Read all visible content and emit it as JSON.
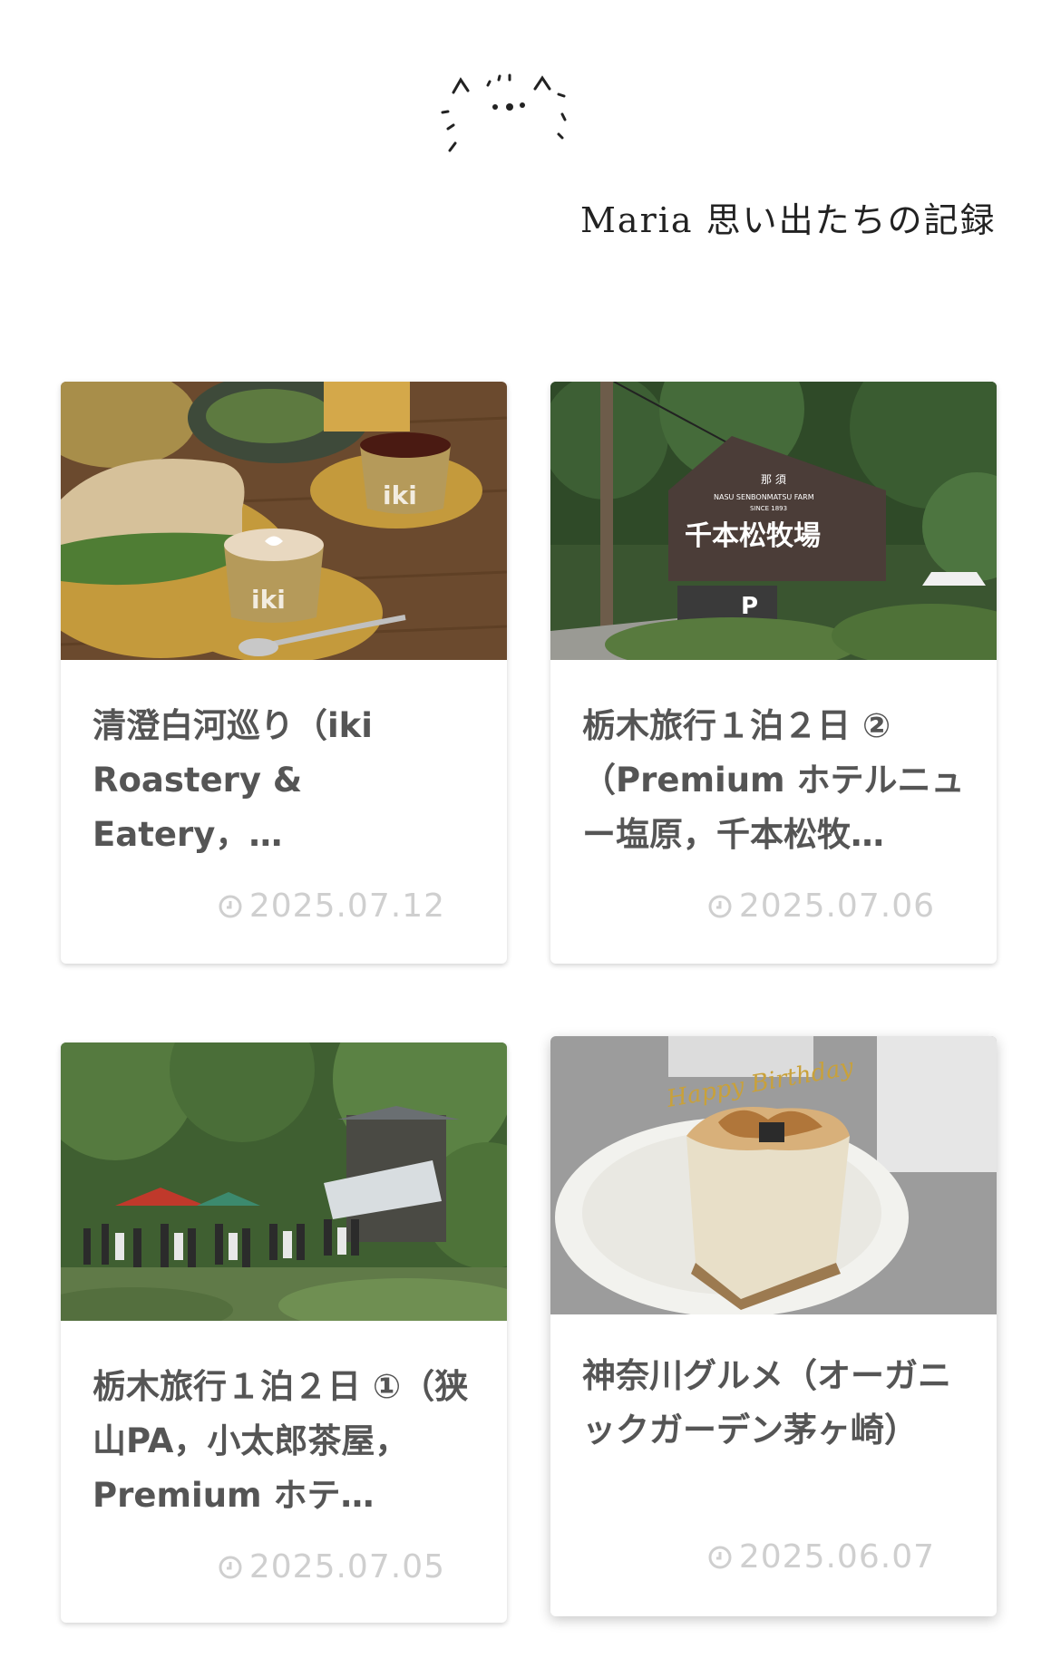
{
  "site": {
    "title": "Maria 思い出たちの記録",
    "logo_icon": "cat-doodle-icon"
  },
  "posts": [
    {
      "title": "清澄白河巡り（iki Roastery & Eatery，…",
      "date": "2025.07.12",
      "thumbnail": "cafe-food-photo",
      "thumbnail_text": "iki"
    },
    {
      "title": "栃木旅行１泊２日 ②（Premium ホテルニュー塩原，千本松牧…",
      "date": "2025.07.06",
      "thumbnail": "farm-sign-photo",
      "thumbnail_text": {
        "sign_small": "那 須",
        "sign_sub": "NASU SENBONMATSU FARM",
        "sign_since": "SINCE 1893",
        "sign_main": "千本松牧場",
        "parking": "P"
      }
    },
    {
      "title": "栃木旅行１泊２日 ①（狭山PA，小太郎茶屋，Premium ホテ…",
      "date": "2025.07.05",
      "thumbnail": "forest-teahouse-photo"
    },
    {
      "title": "神奈川グルメ（オーガニックガーデン茅ヶ崎）",
      "date": "2025.06.07",
      "thumbnail": "birthday-cake-photo",
      "thumbnail_text": "Happy Birthday"
    }
  ],
  "icons": {
    "date": "clock-icon"
  }
}
